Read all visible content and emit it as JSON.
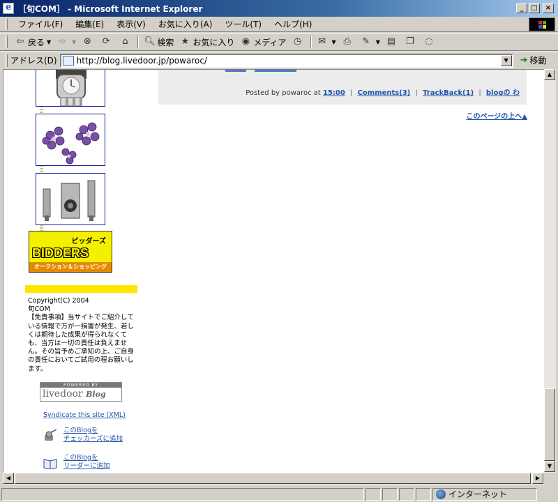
{
  "window": {
    "title": "［旬COM］ - Microsoft Internet Explorer",
    "minimize": "_",
    "maximize": "□",
    "close": "×"
  },
  "menu": [
    "ファイル(F)",
    "編集(E)",
    "表示(V)",
    "お気に入り(A)",
    "ツール(T)",
    "ヘルプ(H)"
  ],
  "toolbar": {
    "back": "戻る",
    "search": "検索",
    "favorites": "お気に入り",
    "media": "メディア"
  },
  "address": {
    "label": "アドレス(D)",
    "url": "http://blog.livedoor.jp/powaroc/",
    "go": "移動"
  },
  "post": {
    "posted_by": "Posted by powaroc at",
    "time": "15:00",
    "comments": "Comments(3)",
    "trackback": "TrackBack(1)",
    "blog_link": "blogの わ",
    "separator": "|"
  },
  "page_top": "このページの上へ▲",
  "bidders": {
    "title": "ビッダーズ",
    "logo": "BIDDERS",
    "tagline": "オークション＆ショッピング"
  },
  "copyright": {
    "line1": "Copyright(C) 2004",
    "line2": "旬COM",
    "disclaimer": "【免責事項】当サイトでご紹介している情報で万が一損害が発生、若しくは期待した成果が得られなくても、当方は一切の責任は負えません。その旨予めご承知の上、ご自身の責任においてご試用の程お願いします。"
  },
  "powered": {
    "label": "POWERED BY",
    "name": "livedoor",
    "sub": "Blog"
  },
  "syndicate": "Syndicate this site (XML)",
  "checkers": {
    "line1": "このBlogを",
    "line2": "チェッカーズに追加"
  },
  "reader": {
    "line1": "このBlogを",
    "line2": "リーダーに追加"
  },
  "status": {
    "zone": "インターネット"
  }
}
